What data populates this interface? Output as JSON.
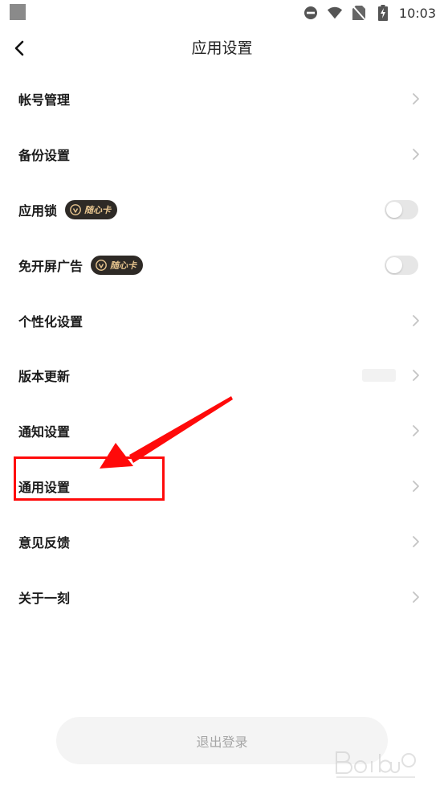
{
  "status_bar": {
    "time": "10:03"
  },
  "header": {
    "title": "应用设置"
  },
  "menu": {
    "items": [
      {
        "label": "帐号管理"
      },
      {
        "label": "备份设置"
      },
      {
        "label": "应用锁",
        "badge": "随心卡",
        "toggle_on": false
      },
      {
        "label": "免开屏广告",
        "badge": "随心卡",
        "toggle_on": false
      },
      {
        "label": "个性化设置"
      },
      {
        "label": "版本更新"
      },
      {
        "label": "通知设置"
      },
      {
        "label": "通用设置"
      },
      {
        "label": "意见反馈"
      },
      {
        "label": "关于一刻"
      }
    ]
  },
  "logout": {
    "label": "退出登录"
  },
  "colors": {
    "badge_bg": "#2e2a26",
    "badge_text": "#e7c58f",
    "annotation_red": "#ff0a0a",
    "toggle_off": "#e6e6e6"
  }
}
